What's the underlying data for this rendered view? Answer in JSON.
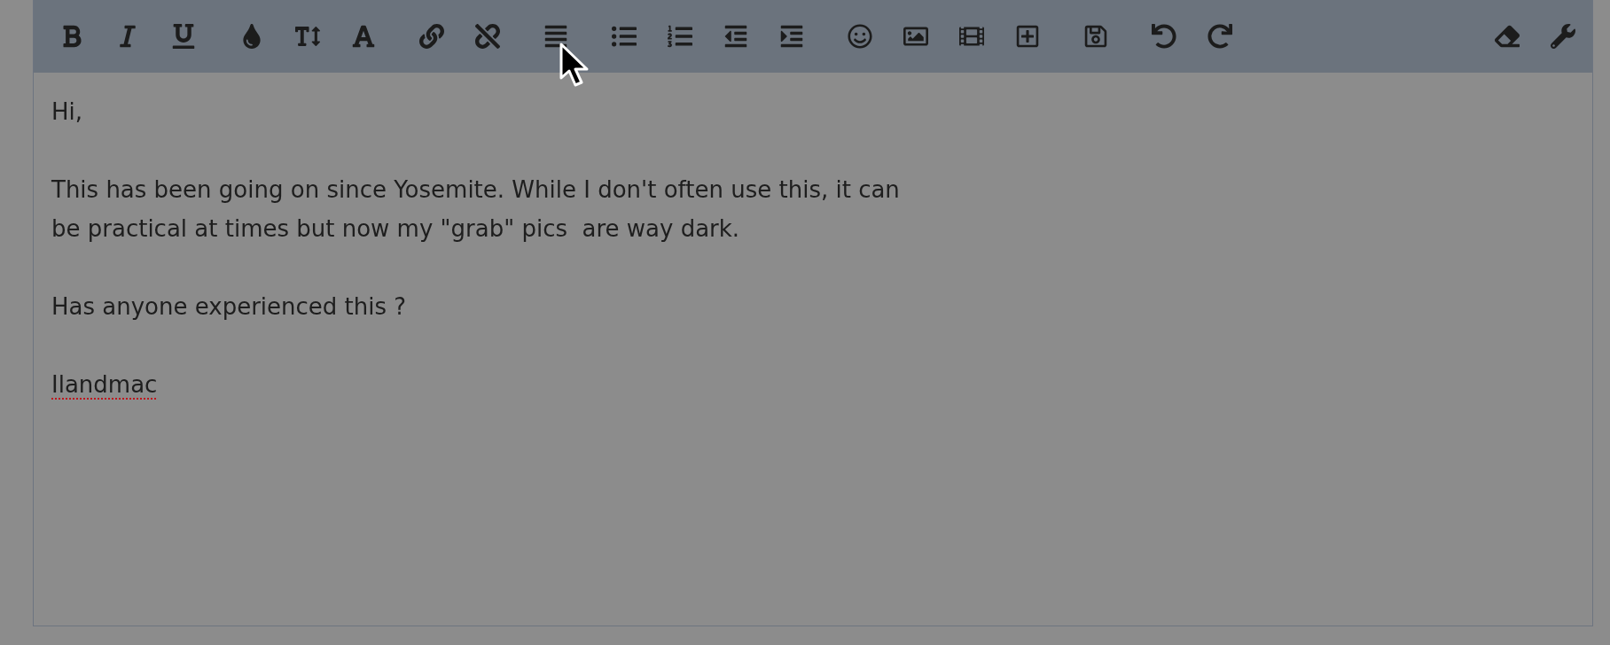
{
  "editor": {
    "paragraphs": [
      {
        "text": "Hi,",
        "misspelled": false
      },
      {
        "text": "This has been going on since Yosemite. While I don't often use this, it can\nbe practical at times but now my \"grab\" pics  are way dark.",
        "misspelled": false
      },
      {
        "text": "Has anyone experienced this ?",
        "misspelled": false
      },
      {
        "text": "Ilandmac",
        "misspelled": true
      }
    ]
  }
}
